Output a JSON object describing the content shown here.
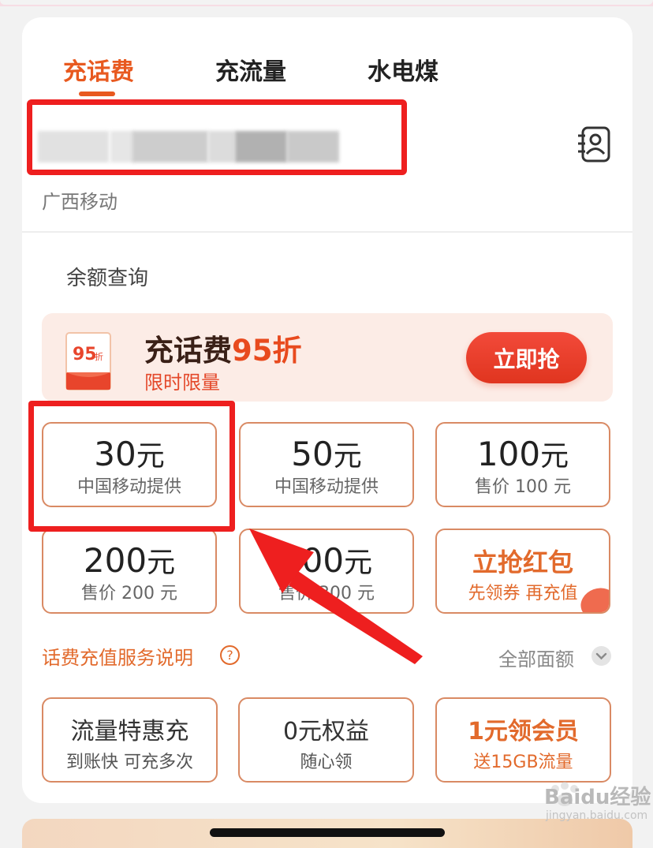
{
  "tabs": [
    {
      "label": "充话费",
      "active": true
    },
    {
      "label": "充流量",
      "active": false
    },
    {
      "label": "水电煤",
      "active": false
    }
  ],
  "carrier": "广西移动",
  "balance_link": "余额查询",
  "promo": {
    "title_prefix": "充话费",
    "title_highlight": "95折",
    "subtitle": "限时限量",
    "badge_number": "95",
    "badge_unit": "折",
    "button_label": "立即抢"
  },
  "denominations": [
    {
      "amount": "30",
      "unit": "元",
      "sub": "中国移动提供"
    },
    {
      "amount": "50",
      "unit": "元",
      "sub": "中国移动提供"
    },
    {
      "amount": "100",
      "unit": "元",
      "sub": "售价 100 元"
    },
    {
      "amount": "200",
      "unit": "元",
      "sub": "售价 200 元"
    },
    {
      "amount": "300",
      "unit": "元",
      "sub": "售价 300 元"
    },
    {
      "title": "立抢红包",
      "sub": "先领券 再充值"
    }
  ],
  "service_link": "话费充值服务说明",
  "help_glyph": "?",
  "all_amounts": "全部面额",
  "bottom_tiles": [
    {
      "title": "流量特惠充",
      "sub": "到账快 可充多次"
    },
    {
      "title": "0元权益",
      "sub": "随心领"
    },
    {
      "title": "1元领会员",
      "sub": "送15GB流量"
    }
  ],
  "watermark": {
    "brand": "Baidu经验",
    "url": "jingyan.baidu.com"
  },
  "colors": {
    "accent": "#e8591f",
    "annotation": "#ee1f1f",
    "tile_border": "#d98a64"
  }
}
